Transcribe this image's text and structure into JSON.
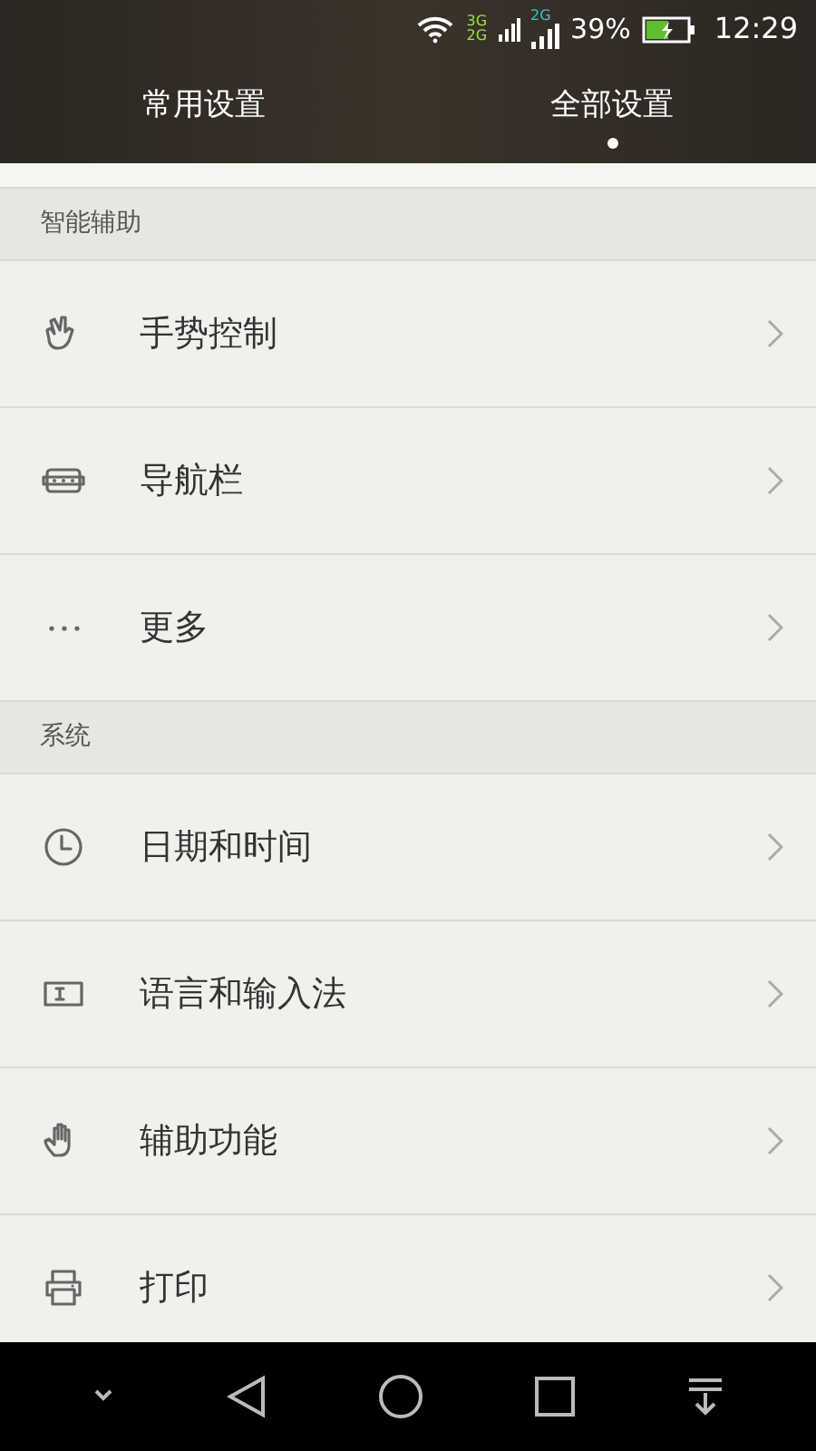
{
  "status_bar": {
    "network_1": "3G",
    "network_2": "2G",
    "network_3": "2G",
    "battery": "39%",
    "time": "12:29"
  },
  "tabs": [
    {
      "label": "常用设置",
      "selected": false
    },
    {
      "label": "全部设置",
      "selected": true
    }
  ],
  "sections": [
    {
      "title": "智能辅助",
      "items": [
        {
          "kind": "gesture",
          "label": "手势控制"
        },
        {
          "kind": "navbar",
          "label": "导航栏"
        },
        {
          "kind": "more",
          "label": "更多"
        }
      ]
    },
    {
      "title": "系统",
      "items": [
        {
          "kind": "clock",
          "label": "日期和时间"
        },
        {
          "kind": "keyboard",
          "label": "语言和输入法"
        },
        {
          "kind": "hand",
          "label": "辅助功能"
        },
        {
          "kind": "printer",
          "label": "打印"
        }
      ]
    }
  ]
}
